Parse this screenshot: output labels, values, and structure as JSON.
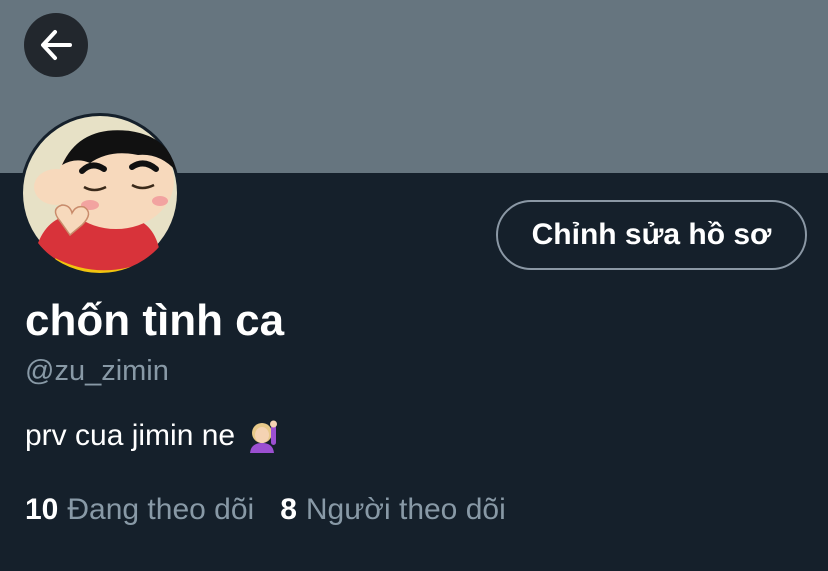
{
  "profile": {
    "display_name": "chốn tình ca",
    "handle": "@zu_zimin",
    "bio": "prv cua jimin ne",
    "bio_emoji": "person-raising-hand-emoji",
    "edit_button_label": "Chỉnh sửa hồ sơ"
  },
  "stats": {
    "following_count": "10",
    "following_label": "Đang theo dõi",
    "followers_count": "8",
    "followers_label": "Người theo dõi"
  },
  "icons": {
    "back": "arrow-left-icon",
    "avatar": "cartoon-avatar"
  },
  "colors": {
    "background": "#15202b",
    "banner": "#66757f",
    "secondary_text": "#8899a6",
    "button_border": "#8b98a5"
  }
}
